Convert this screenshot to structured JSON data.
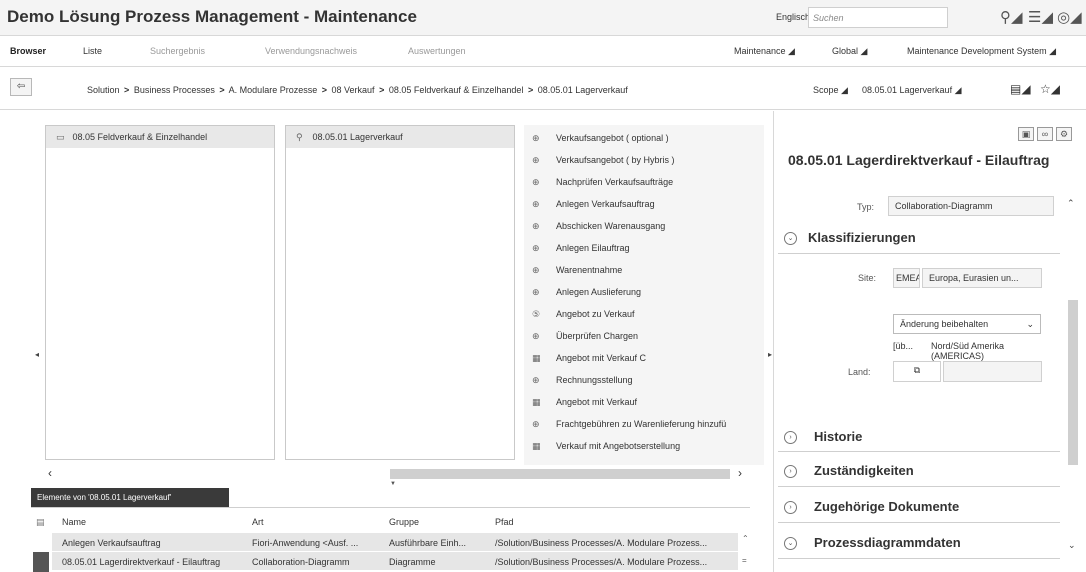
{
  "header": {
    "title": "Demo Lösung Prozess Management - Maintenance",
    "language": "Englisch",
    "search_placeholder": "Suchen"
  },
  "menu": {
    "items": [
      "Browser",
      "Liste",
      "Suchergebnis",
      "Verwendungsnachweis",
      "Auswertungen"
    ],
    "right": [
      "Maintenance",
      "Global",
      "Maintenance Development System"
    ]
  },
  "breadcrumb": {
    "items": [
      "Solution",
      "Business Processes",
      "A. Modulare Prozesse",
      "08 Verkauf",
      "08.05 Feldverkauf & Einzelhandel",
      "08.05.01 Lagerverkauf"
    ],
    "separator": ">",
    "scope_label": "Scope",
    "scope_value": "08.05.01 Lagerverkauf"
  },
  "columns": {
    "col1_selected": "08.05 Feldverkauf & Einzelhandel",
    "col2_selected": "08.05.01 Lagerverkauf",
    "steps": [
      {
        "label": "Verkaufsangebot ( optional )",
        "icon": "step-icon"
      },
      {
        "label": "Verkaufsangebot ( by Hybris )",
        "icon": "step-icon"
      },
      {
        "label": "Nachprüfen Verkaufsaufträge",
        "icon": "step-icon"
      },
      {
        "label": "Anlegen Verkaufsauftrag",
        "icon": "step-icon"
      },
      {
        "label": "Abschicken Warenausgang",
        "icon": "step-icon"
      },
      {
        "label": "Anlegen Eilauftrag",
        "icon": "step-icon"
      },
      {
        "label": "Warenentnahme",
        "icon": "step-icon"
      },
      {
        "label": "Anlegen Auslieferung",
        "icon": "step-icon"
      },
      {
        "label": "Angebot zu Verkauf",
        "icon": "subprocess-icon"
      },
      {
        "label": "Überprüfen Chargen",
        "icon": "step-icon"
      },
      {
        "label": "Angebot mit Verkauf C",
        "icon": "flow-icon"
      },
      {
        "label": "Rechnungsstellung",
        "icon": "step-icon"
      },
      {
        "label": "Angebot mit Verkauf",
        "icon": "flow-icon"
      },
      {
        "label": "Frachtgebühren zu Warenlieferung hinzufü",
        "icon": "step-icon"
      },
      {
        "label": "Verkauf mit Angebotserstellung",
        "icon": "flow-icon"
      }
    ]
  },
  "elements": {
    "tab_title": "Elemente von '08.05.01 Lagerverkauf'",
    "headers": [
      "Name",
      "Art",
      "Gruppe",
      "Pfad"
    ],
    "rows": [
      [
        "Anlegen Verkaufsauftrag",
        "Fiori-Anwendung <Ausf. ...",
        "Ausführbare Einh...",
        "/Solution/Business Processes/A. Modulare Prozess..."
      ],
      [
        "08.05.01 Lagerdirektverkauf - Eilauftrag",
        "Collaboration-Diagramm",
        "Diagramme",
        "/Solution/Business Processes/A. Modulare Prozess..."
      ]
    ]
  },
  "detail": {
    "title": "08.05.01 Lagerdirektverkauf - Eilauftrag",
    "typ_label": "Typ:",
    "typ_value": "Collaboration-Diagramm",
    "sections": [
      "Klassifizierungen",
      "Historie",
      "Zuständigkeiten",
      "Zugehörige Dokumente",
      "Prozessdiagrammdaten"
    ],
    "site_label": "Site:",
    "site_code": "EMEA",
    "site_value": "Europa, Eurasien un...",
    "change_option": "Änderung beibehalten",
    "land_prefix": "[üb...",
    "land_value": "Nord/Süd Amerika (AMERICAS)",
    "land_label": "Land:"
  }
}
